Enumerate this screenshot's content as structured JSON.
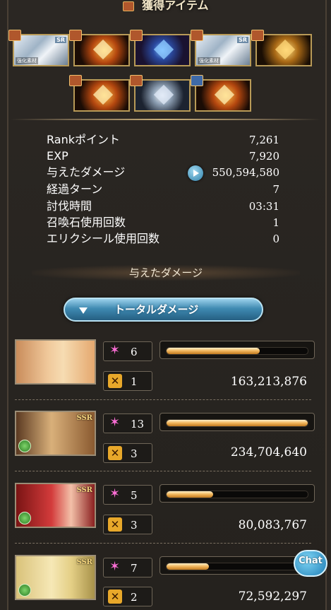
{
  "header": {
    "title": "獲得アイテム"
  },
  "items": [
    {
      "type": "steel",
      "badge": "SR",
      "tag": "強化素材"
    },
    {
      "type": "orange",
      "badge": "",
      "tag": ""
    },
    {
      "type": "blue",
      "badge": "",
      "tag": ""
    },
    {
      "type": "steel",
      "badge": "SR",
      "tag": "強化素材"
    },
    {
      "type": "gold",
      "badge": "",
      "tag": ""
    },
    {
      "type": "orange",
      "badge": "",
      "tag": ""
    },
    {
      "type": "silver",
      "badge": "",
      "tag": ""
    },
    {
      "type": "orange",
      "badge": "",
      "tag": ""
    }
  ],
  "stats": [
    {
      "label": "Rankポイント",
      "value": "7,261"
    },
    {
      "label": "EXP",
      "value": "7,920"
    },
    {
      "label": "与えたダメージ",
      "value": "550,594,580"
    },
    {
      "label": "経過ターン",
      "value": "7"
    },
    {
      "label": "討伐時間",
      "value": "03:31"
    },
    {
      "label": "召喚石使用回数",
      "value": "1"
    },
    {
      "label": "エリクシール使用回数",
      "value": "0"
    }
  ],
  "section_title": "与えたダメージ",
  "total_button_label": "トータルダメージ",
  "characters": [
    {
      "hits": "6",
      "specials": "1",
      "damage": "163,213,876",
      "fill": 0.66,
      "ssr": "",
      "element": ""
    },
    {
      "hits": "13",
      "specials": "3",
      "damage": "234,704,640",
      "fill": 1.0,
      "ssr": "SSR",
      "element": "wind"
    },
    {
      "hits": "5",
      "specials": "3",
      "damage": "80,083,767",
      "fill": 0.33,
      "ssr": "SSR",
      "element": "wind"
    },
    {
      "hits": "7",
      "specials": "2",
      "damage": "72,592,297",
      "fill": 0.3,
      "ssr": "SSR",
      "element": "wind"
    }
  ],
  "chat_label": "Chat"
}
